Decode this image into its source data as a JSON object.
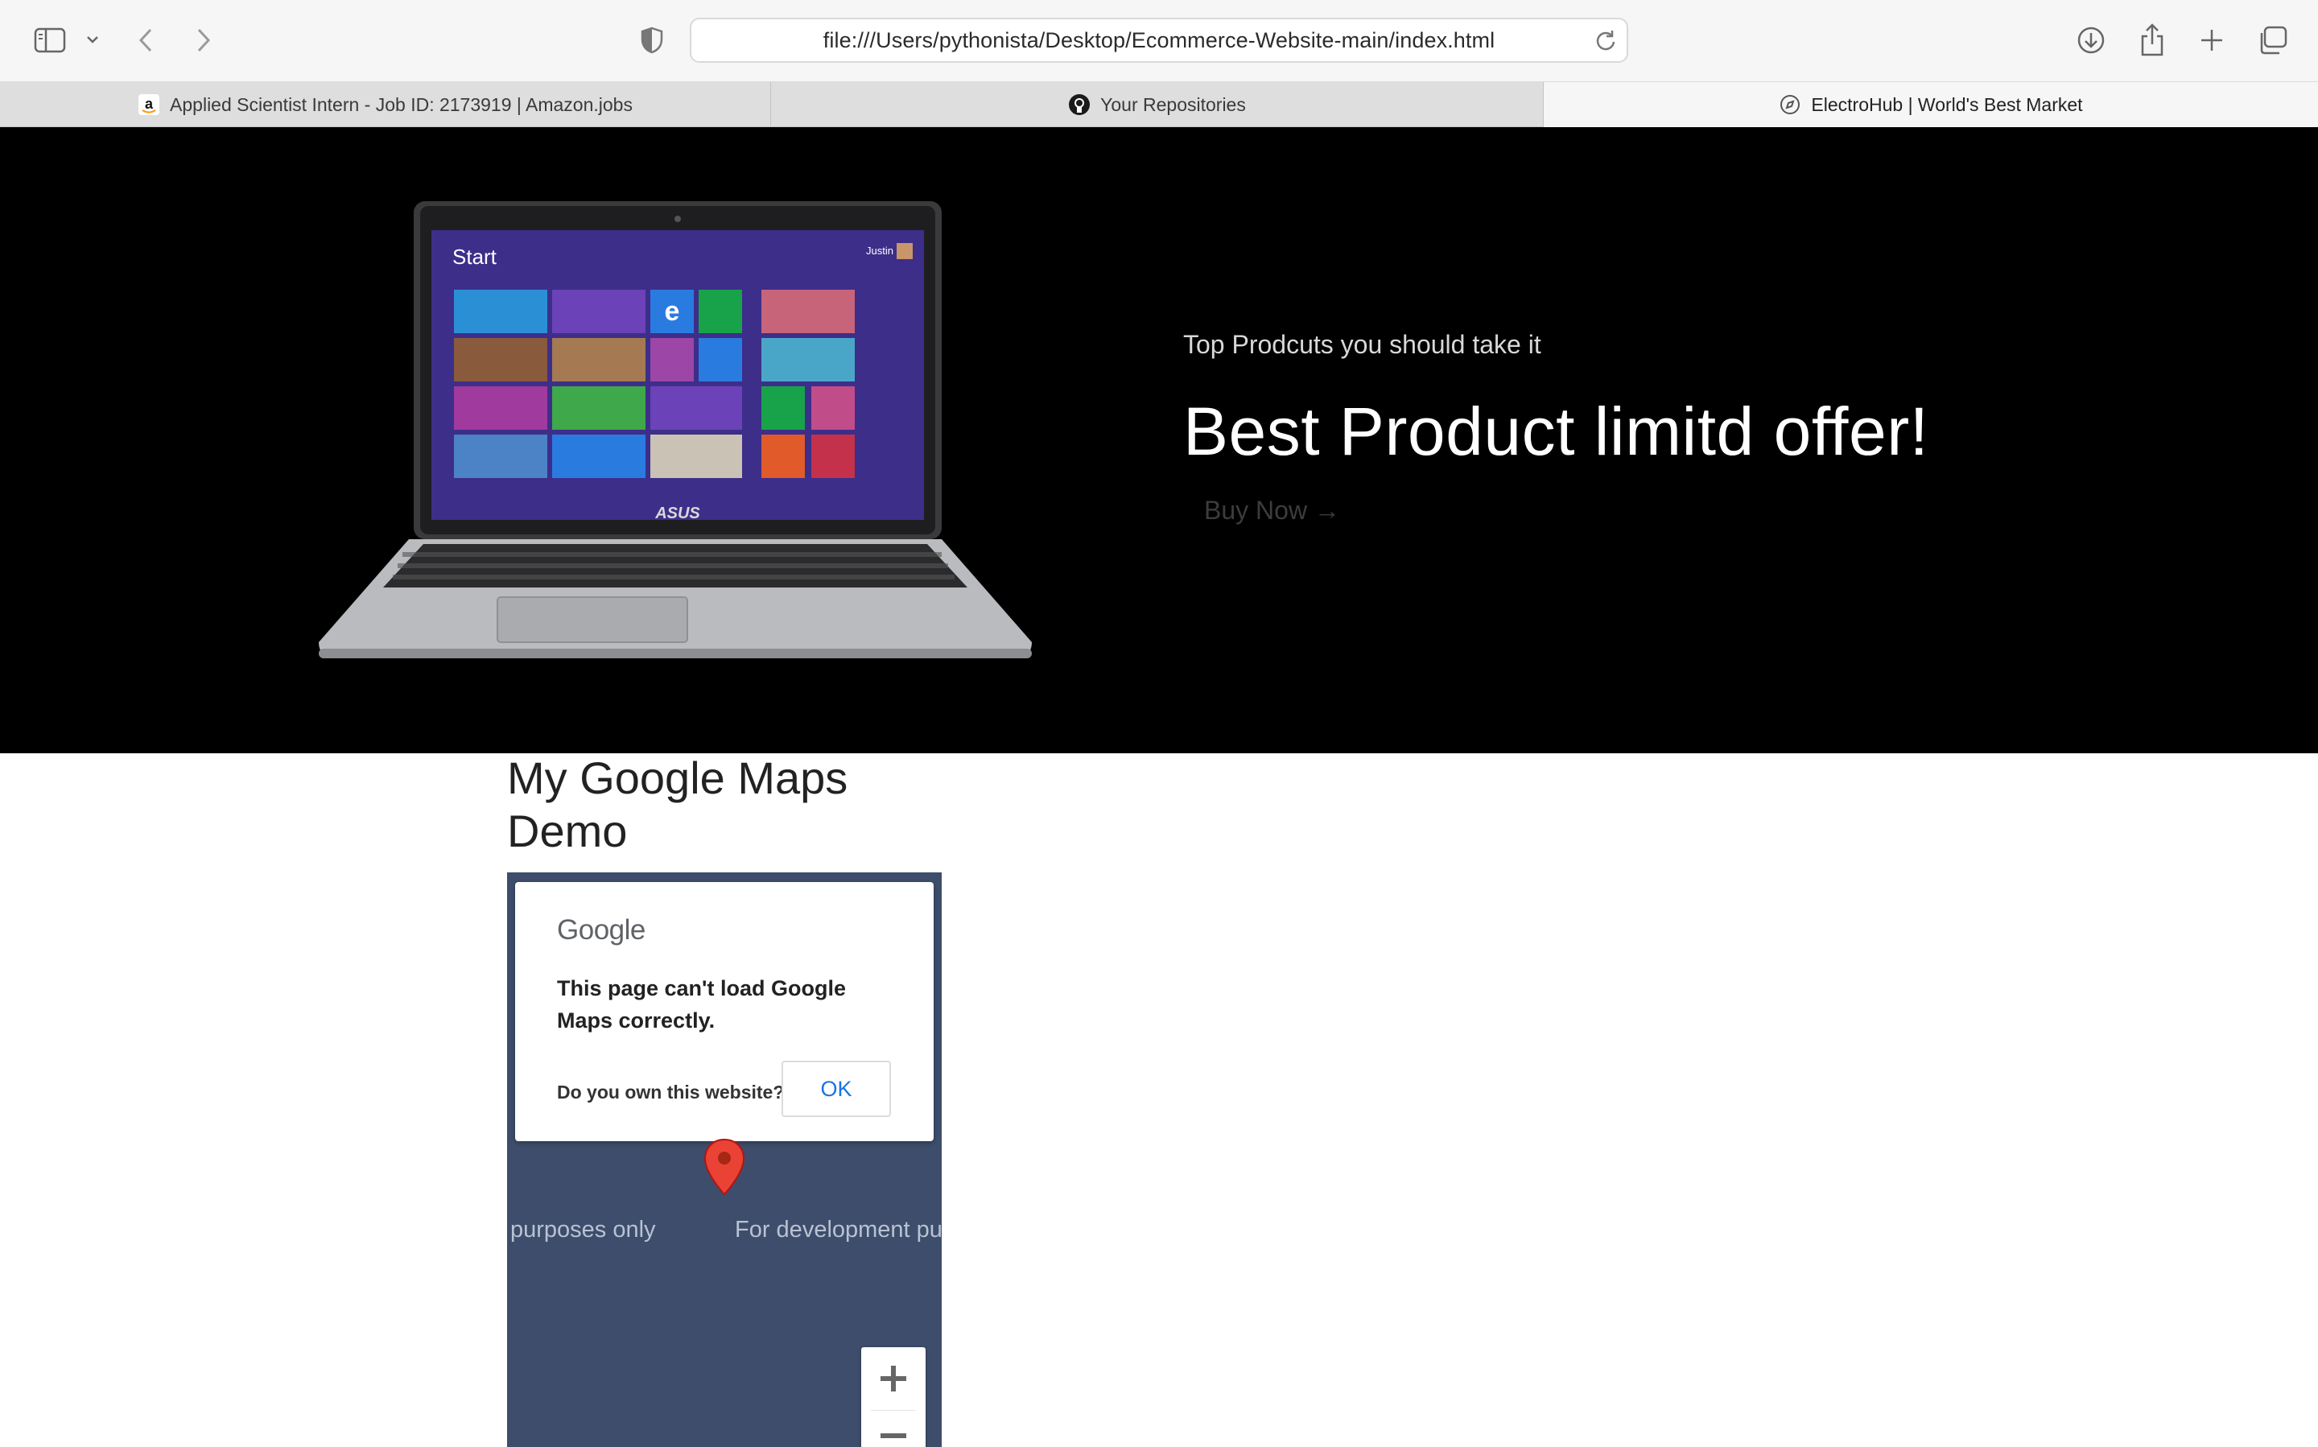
{
  "browser": {
    "url": "file:///Users/pythonista/Desktop/Ecommerce-Website-main/index.html",
    "tabs": [
      {
        "label": "Applied Scientist Intern - Job ID: 2173919 | Amazon.jobs",
        "favicon": "amazon-icon"
      },
      {
        "label": "Your Repositories",
        "favicon": "github-icon"
      },
      {
        "label": "ElectroHub | World's Best Market",
        "favicon": "compass-icon",
        "active": true
      }
    ]
  },
  "hero": {
    "subtitle": "Top Prodcuts you should take it",
    "title": "Best Product limitd offer!",
    "buy_label": "Buy Now →",
    "laptop": {
      "brand": "ASUS",
      "screen_title": "Start",
      "user": "Justin"
    }
  },
  "map_section": {
    "title": "My Google Maps Demo",
    "dialog": {
      "logo": "Google",
      "message": "This page can't load Google Maps correctly.",
      "question": "Do you own this website?",
      "ok_label": "OK"
    },
    "watermark_left": "purposes only",
    "watermark_right": "For development pu",
    "zoom_in": "+",
    "zoom_out": "−"
  },
  "colors": {
    "hero_bg": "#000000",
    "map_bg": "#3d4d6b",
    "google_blue": "#1a73e8",
    "pin_red": "#ea4335"
  }
}
